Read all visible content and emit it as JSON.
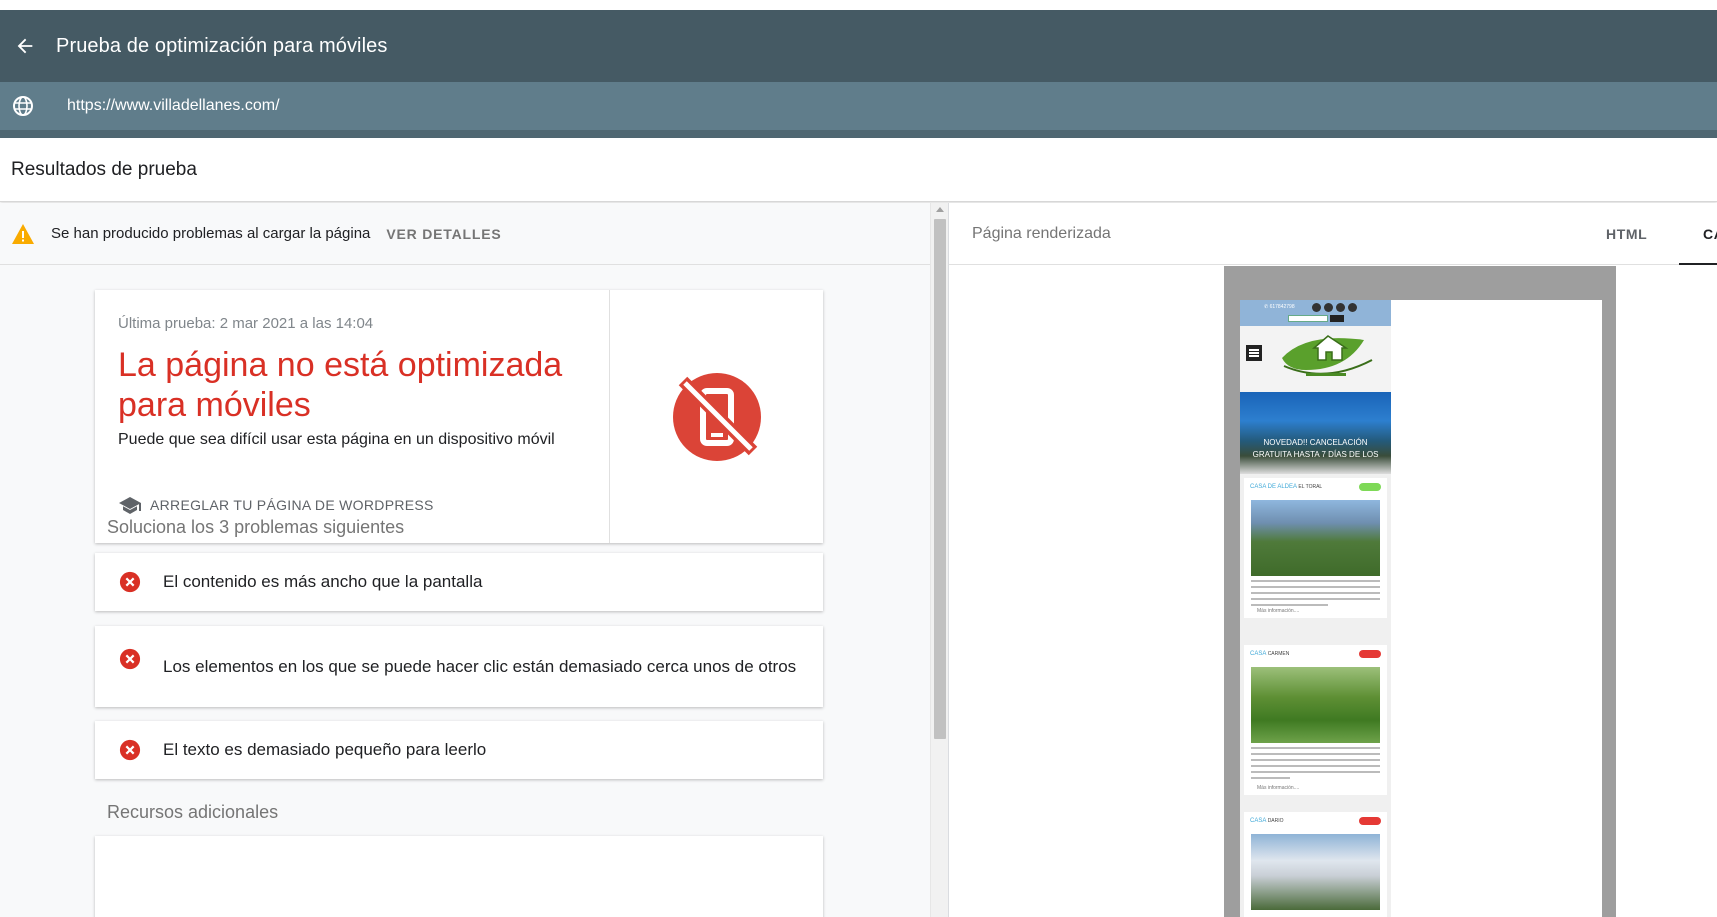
{
  "appbar": {
    "title": "Prueba de optimización para móviles"
  },
  "urlbar": {
    "url": "https://www.villadellanes.com/"
  },
  "results": {
    "title": "Resultados de prueba"
  },
  "warning": {
    "text": "Se han producido problemas al cargar la página",
    "link": "VER DETALLES"
  },
  "summary": {
    "date": "Última prueba: 2 mar 2021 a las 14:04",
    "headline": "La página no está optimizada para móviles",
    "subtitle": "Puede que sea difícil usar esta página en un dispositivo móvil",
    "fix_link": "ARREGLAR TU PÁGINA DE WORDPRESS"
  },
  "problems": {
    "heading": "Soluciona los 3 problemas siguientes",
    "items": [
      "El contenido es más ancho que la pantalla",
      "Los elementos en los que se puede hacer clic están demasiado cerca unos de otros",
      "El texto es demasiado pequeño para leerlo"
    ]
  },
  "resources": {
    "heading": "Recursos adicionales"
  },
  "rendered": {
    "title": "Página renderizada",
    "tab_html": "HTML",
    "tab_capture": "CA"
  },
  "preview": {
    "phone_number": "617842798",
    "hero_caption_1": "NOVEDAD!! CANCELACIÓN",
    "hero_caption_2": "GRATUITA HASTA 7 DÍAS DE LOS",
    "cards": [
      {
        "name": "CASA DE ALDEA",
        "sub": "EL TORAL",
        "more": "Más información...."
      },
      {
        "name": "CASA",
        "sub": "CARMEN",
        "more": "Más información...."
      },
      {
        "name": "CASA",
        "sub": "DARIO"
      }
    ]
  },
  "colors": {
    "appbar": "#455a64",
    "urlbar": "#607d8b",
    "error": "#d93025",
    "warning": "#f9ab00"
  }
}
